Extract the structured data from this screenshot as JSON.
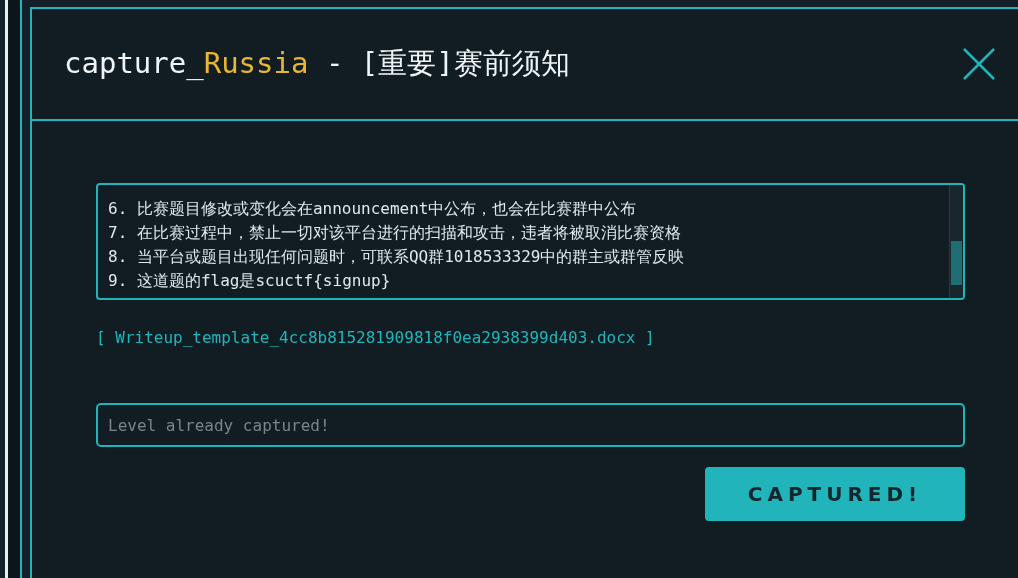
{
  "modal": {
    "title": {
      "prefix": "capture_",
      "name": "Russia",
      "suffix": " - [重要]赛前须知"
    },
    "description_lines": [
      "6. 比赛题目修改或变化会在announcement中公布，也会在比赛群中公布",
      "7. 在比赛过程中，禁止一切对该平台进行的扫描和攻击，违者将被取消比赛资格",
      "8. 当平台或题目出现任何问题时，可联系QQ群1018533329中的群主或群管反映",
      "9. 这道题的flag是scuctf{signup}"
    ],
    "attachment": "[ Writeup_template_4cc8b815281909818f0ea2938399d403.docx ]",
    "flag_field": {
      "placeholder": "Level already captured!"
    },
    "submit_button": "CAPTURED!"
  }
}
